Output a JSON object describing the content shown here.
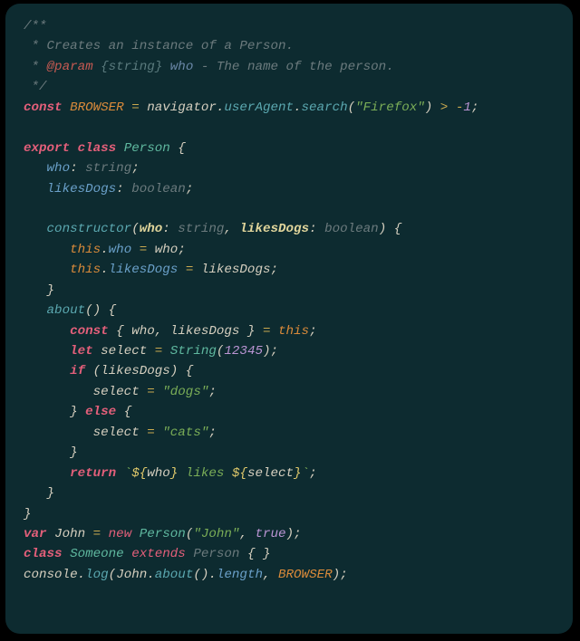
{
  "code": {
    "lines": [
      [
        {
          "cls": "comment",
          "t": "/**"
        }
      ],
      [
        {
          "cls": "comment",
          "t": " * Creates an instance of a Person."
        }
      ],
      [
        {
          "cls": "comment",
          "t": " * "
        },
        {
          "cls": "doctag",
          "t": "@param"
        },
        {
          "cls": "comment",
          "t": " "
        },
        {
          "cls": "doctype",
          "t": "{string}"
        },
        {
          "cls": "comment",
          "t": " "
        },
        {
          "cls": "docparam",
          "t": "who"
        },
        {
          "cls": "comment",
          "t": " - The name of the person."
        }
      ],
      [
        {
          "cls": "comment",
          "t": " */"
        }
      ],
      [
        {
          "cls": "keyword",
          "t": "const"
        },
        {
          "cls": "punct",
          "t": " "
        },
        {
          "cls": "constname",
          "t": "BROWSER"
        },
        {
          "cls": "punct",
          "t": " "
        },
        {
          "cls": "operator",
          "t": "="
        },
        {
          "cls": "punct",
          "t": " "
        },
        {
          "cls": "ident",
          "t": "navigator"
        },
        {
          "cls": "punct",
          "t": "."
        },
        {
          "cls": "methodcall",
          "t": "userAgent"
        },
        {
          "cls": "punct",
          "t": "."
        },
        {
          "cls": "methodcall",
          "t": "search"
        },
        {
          "cls": "punct",
          "t": "("
        },
        {
          "cls": "string",
          "t": "\"Firefox\""
        },
        {
          "cls": "punct",
          "t": ") "
        },
        {
          "cls": "operator",
          "t": ">"
        },
        {
          "cls": "punct",
          "t": " "
        },
        {
          "cls": "operator",
          "t": "-"
        },
        {
          "cls": "number",
          "t": "1"
        },
        {
          "cls": "punct",
          "t": ";"
        }
      ],
      [
        {
          "cls": "punct",
          "t": ""
        }
      ],
      [
        {
          "cls": "keyword",
          "t": "export"
        },
        {
          "cls": "punct",
          "t": " "
        },
        {
          "cls": "keyword",
          "t": "class"
        },
        {
          "cls": "punct",
          "t": " "
        },
        {
          "cls": "classname",
          "t": "Person"
        },
        {
          "cls": "punct",
          "t": " {"
        }
      ],
      [
        {
          "cls": "punct",
          "t": "   "
        },
        {
          "cls": "prop",
          "t": "who"
        },
        {
          "cls": "punct",
          "t": ": "
        },
        {
          "cls": "type",
          "t": "string"
        },
        {
          "cls": "punct",
          "t": ";"
        }
      ],
      [
        {
          "cls": "punct",
          "t": "   "
        },
        {
          "cls": "prop",
          "t": "likesDogs"
        },
        {
          "cls": "punct",
          "t": ": "
        },
        {
          "cls": "type",
          "t": "boolean"
        },
        {
          "cls": "punct",
          "t": ";"
        }
      ],
      [
        {
          "cls": "punct",
          "t": ""
        }
      ],
      [
        {
          "cls": "punct",
          "t": "   "
        },
        {
          "cls": "funcname",
          "t": "constructor"
        },
        {
          "cls": "punct",
          "t": "("
        },
        {
          "cls": "paramname",
          "t": "who"
        },
        {
          "cls": "punct",
          "t": ": "
        },
        {
          "cls": "type",
          "t": "string"
        },
        {
          "cls": "punct",
          "t": ", "
        },
        {
          "cls": "paramname",
          "t": "likesDogs"
        },
        {
          "cls": "punct",
          "t": ": "
        },
        {
          "cls": "type",
          "t": "boolean"
        },
        {
          "cls": "punct",
          "t": ") {"
        }
      ],
      [
        {
          "cls": "punct",
          "t": "      "
        },
        {
          "cls": "this",
          "t": "this"
        },
        {
          "cls": "punct",
          "t": "."
        },
        {
          "cls": "prop",
          "t": "who"
        },
        {
          "cls": "punct",
          "t": " "
        },
        {
          "cls": "operator",
          "t": "="
        },
        {
          "cls": "punct",
          "t": " "
        },
        {
          "cls": "ident",
          "t": "who"
        },
        {
          "cls": "punct",
          "t": ";"
        }
      ],
      [
        {
          "cls": "punct",
          "t": "      "
        },
        {
          "cls": "this",
          "t": "this"
        },
        {
          "cls": "punct",
          "t": "."
        },
        {
          "cls": "prop",
          "t": "likesDogs"
        },
        {
          "cls": "punct",
          "t": " "
        },
        {
          "cls": "operator",
          "t": "="
        },
        {
          "cls": "punct",
          "t": " "
        },
        {
          "cls": "ident",
          "t": "likesDogs"
        },
        {
          "cls": "punct",
          "t": ";"
        }
      ],
      [
        {
          "cls": "punct",
          "t": "   }"
        }
      ],
      [
        {
          "cls": "punct",
          "t": "   "
        },
        {
          "cls": "funcname",
          "t": "about"
        },
        {
          "cls": "punct",
          "t": "() {"
        }
      ],
      [
        {
          "cls": "punct",
          "t": "      "
        },
        {
          "cls": "keyword",
          "t": "const"
        },
        {
          "cls": "punct",
          "t": " { "
        },
        {
          "cls": "ident",
          "t": "who"
        },
        {
          "cls": "punct",
          "t": ", "
        },
        {
          "cls": "ident",
          "t": "likesDogs"
        },
        {
          "cls": "punct",
          "t": " } "
        },
        {
          "cls": "operator",
          "t": "="
        },
        {
          "cls": "punct",
          "t": " "
        },
        {
          "cls": "this",
          "t": "this"
        },
        {
          "cls": "punct",
          "t": ";"
        }
      ],
      [
        {
          "cls": "punct",
          "t": "      "
        },
        {
          "cls": "keyword",
          "t": "let"
        },
        {
          "cls": "punct",
          "t": " "
        },
        {
          "cls": "ident",
          "t": "select"
        },
        {
          "cls": "punct",
          "t": " "
        },
        {
          "cls": "operator",
          "t": "="
        },
        {
          "cls": "punct",
          "t": " "
        },
        {
          "cls": "builtin",
          "t": "String"
        },
        {
          "cls": "punct",
          "t": "("
        },
        {
          "cls": "number",
          "t": "12345"
        },
        {
          "cls": "punct",
          "t": ");"
        }
      ],
      [
        {
          "cls": "punct",
          "t": "      "
        },
        {
          "cls": "keyword",
          "t": "if"
        },
        {
          "cls": "punct",
          "t": " ("
        },
        {
          "cls": "ident",
          "t": "likesDogs"
        },
        {
          "cls": "punct",
          "t": ") {"
        }
      ],
      [
        {
          "cls": "punct",
          "t": "         "
        },
        {
          "cls": "ident",
          "t": "select"
        },
        {
          "cls": "punct",
          "t": " "
        },
        {
          "cls": "operator",
          "t": "="
        },
        {
          "cls": "punct",
          "t": " "
        },
        {
          "cls": "string",
          "t": "\"dogs\""
        },
        {
          "cls": "punct",
          "t": ";"
        }
      ],
      [
        {
          "cls": "punct",
          "t": "      } "
        },
        {
          "cls": "keyword",
          "t": "else"
        },
        {
          "cls": "punct",
          "t": " {"
        }
      ],
      [
        {
          "cls": "punct",
          "t": "         "
        },
        {
          "cls": "ident",
          "t": "select"
        },
        {
          "cls": "punct",
          "t": " "
        },
        {
          "cls": "operator",
          "t": "="
        },
        {
          "cls": "punct",
          "t": " "
        },
        {
          "cls": "string",
          "t": "\"cats\""
        },
        {
          "cls": "punct",
          "t": ";"
        }
      ],
      [
        {
          "cls": "punct",
          "t": "      }"
        }
      ],
      [
        {
          "cls": "punct",
          "t": "      "
        },
        {
          "cls": "keyword",
          "t": "return"
        },
        {
          "cls": "punct",
          "t": " "
        },
        {
          "cls": "template",
          "t": "`"
        },
        {
          "cls": "interp",
          "t": "${"
        },
        {
          "cls": "ident",
          "t": "who"
        },
        {
          "cls": "interp",
          "t": "}"
        },
        {
          "cls": "template",
          "t": " likes "
        },
        {
          "cls": "interp",
          "t": "${"
        },
        {
          "cls": "ident",
          "t": "select"
        },
        {
          "cls": "interp",
          "t": "}"
        },
        {
          "cls": "template",
          "t": "`"
        },
        {
          "cls": "punct",
          "t": ";"
        }
      ],
      [
        {
          "cls": "punct",
          "t": "   }"
        }
      ],
      [
        {
          "cls": "punct",
          "t": "}"
        }
      ],
      [
        {
          "cls": "keyword",
          "t": "var"
        },
        {
          "cls": "punct",
          "t": " "
        },
        {
          "cls": "ident",
          "t": "John"
        },
        {
          "cls": "punct",
          "t": " "
        },
        {
          "cls": "operator",
          "t": "="
        },
        {
          "cls": "punct",
          "t": " "
        },
        {
          "cls": "keyword2",
          "t": "new"
        },
        {
          "cls": "punct",
          "t": " "
        },
        {
          "cls": "classname",
          "t": "Person"
        },
        {
          "cls": "punct",
          "t": "("
        },
        {
          "cls": "string",
          "t": "\"John\""
        },
        {
          "cls": "punct",
          "t": ", "
        },
        {
          "cls": "bool",
          "t": "true"
        },
        {
          "cls": "punct",
          "t": ");"
        }
      ],
      [
        {
          "cls": "keyword",
          "t": "class"
        },
        {
          "cls": "punct",
          "t": " "
        },
        {
          "cls": "classname",
          "t": "Someone"
        },
        {
          "cls": "punct",
          "t": " "
        },
        {
          "cls": "keyword2",
          "t": "extends"
        },
        {
          "cls": "punct",
          "t": " "
        },
        {
          "cls": "type",
          "t": "Person"
        },
        {
          "cls": "punct",
          "t": " { }"
        }
      ],
      [
        {
          "cls": "ident",
          "t": "console"
        },
        {
          "cls": "punct",
          "t": "."
        },
        {
          "cls": "methodcall",
          "t": "log"
        },
        {
          "cls": "punct",
          "t": "("
        },
        {
          "cls": "ident",
          "t": "John"
        },
        {
          "cls": "punct",
          "t": "."
        },
        {
          "cls": "methodcall",
          "t": "about"
        },
        {
          "cls": "punct",
          "t": "()."
        },
        {
          "cls": "prop",
          "t": "length"
        },
        {
          "cls": "punct",
          "t": ", "
        },
        {
          "cls": "constname",
          "t": "BROWSER"
        },
        {
          "cls": "punct",
          "t": ");"
        }
      ]
    ]
  }
}
